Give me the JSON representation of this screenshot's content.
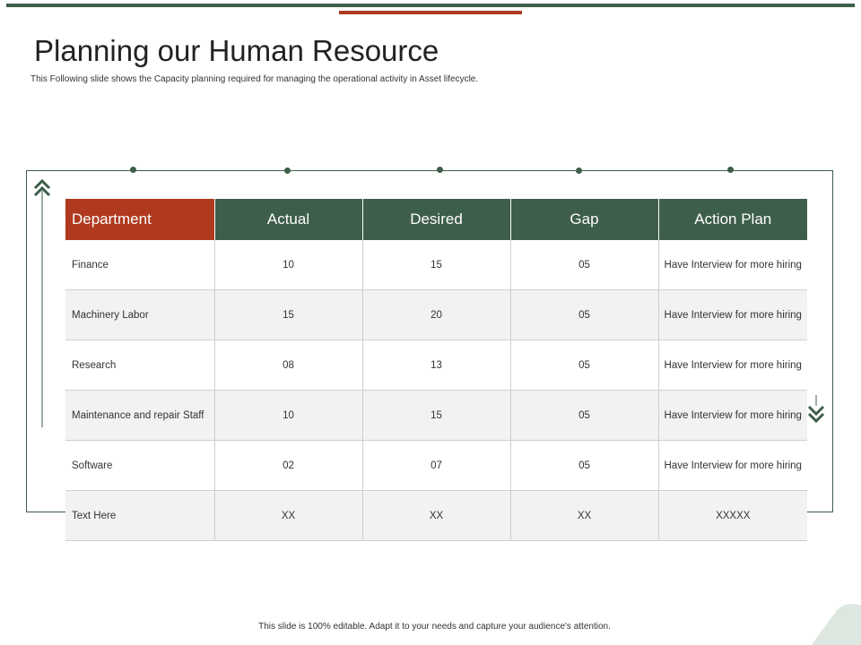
{
  "header": {
    "title": "Planning our Human Resource",
    "subtitle": "This Following slide shows the Capacity planning required for managing the operational activity in Asset lifecycle."
  },
  "table": {
    "columns": [
      "Department",
      "Actual",
      "Desired",
      "Gap",
      "Action Plan"
    ],
    "rows": [
      [
        "Finance",
        "10",
        "15",
        "05",
        "Have Interview for more hiring"
      ],
      [
        "Machinery Labor",
        "15",
        "20",
        "05",
        "Have Interview for more hiring"
      ],
      [
        "Research",
        "08",
        "13",
        "05",
        "Have Interview for more hiring"
      ],
      [
        "Maintenance and repair Staff",
        "10",
        "15",
        "05",
        "Have Interview for more hiring"
      ],
      [
        "Software",
        "02",
        "07",
        "05",
        "Have Interview for more hiring"
      ],
      [
        "Text Here",
        "XX",
        "XX",
        "XX",
        "XXXXX"
      ]
    ]
  },
  "footer": {
    "note": "This slide is 100% editable. Adapt it to your needs and capture your audience's attention."
  },
  "colors": {
    "green": "#3d5e49",
    "red": "#b03a1f",
    "blob": "#dde7df"
  },
  "icons": {
    "up": "double-chevron-up-icon",
    "down": "double-chevron-down-icon"
  }
}
